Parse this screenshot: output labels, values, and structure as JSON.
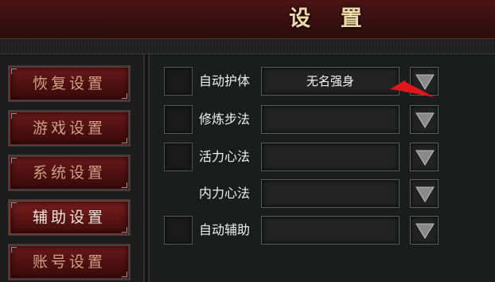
{
  "header": {
    "title": "设  置"
  },
  "sidebar": {
    "items": [
      {
        "label": "恢复设置",
        "active": false
      },
      {
        "label": "游戏设置",
        "active": false
      },
      {
        "label": "系统设置",
        "active": false
      },
      {
        "label": "辅助设置",
        "active": true
      },
      {
        "label": "账号设置",
        "active": false
      }
    ]
  },
  "rows": [
    {
      "label": "自动护体",
      "value": "无名强身",
      "has_checkbox": true
    },
    {
      "label": "修炼步法",
      "value": "",
      "has_checkbox": true
    },
    {
      "label": "活力心法",
      "value": "",
      "has_checkbox": true
    },
    {
      "label": "内力心法",
      "value": "",
      "has_checkbox": false
    },
    {
      "label": "自动辅助",
      "value": "",
      "has_checkbox": true
    }
  ],
  "icons": {
    "dropdown": "triangle-down-icon",
    "annotation": "red-arrow-icon"
  },
  "colors": {
    "header_red": "#4a1414",
    "button_red": "#6a1a1a",
    "annotation_red": "#e0161b"
  }
}
